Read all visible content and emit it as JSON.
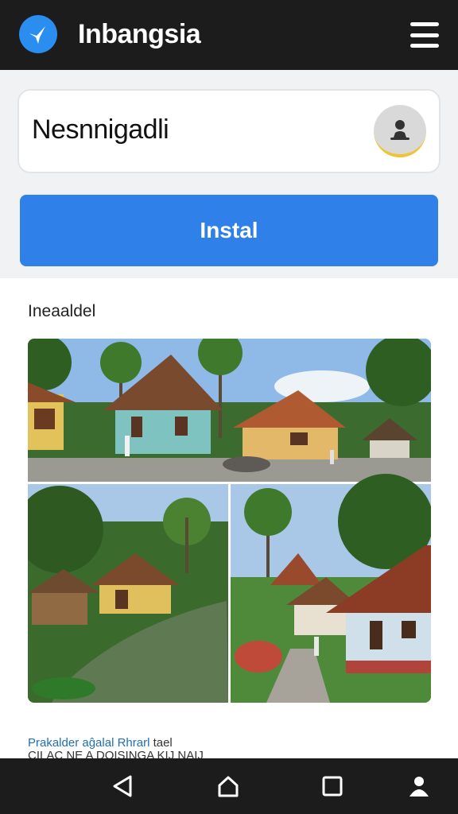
{
  "app": {
    "title": "Inbangsia",
    "logo_icon": "bird-icon",
    "menu_icon": "hamburger-menu-icon"
  },
  "search": {
    "value": "Nesnnigadli",
    "avatar_icon": "user-avatar-icon"
  },
  "install_button": {
    "label": "Instal"
  },
  "section": {
    "title": "Ineaaldel"
  },
  "gallery": {
    "description": "Collage of traditional village houses among palm trees, a pond and stone paths"
  },
  "caption": {
    "link_text": "Prakalder aĝalal Rhrarl",
    "rest_text": " tael",
    "subline": "CILAC NE A DOISINGA KIJ NAIJ"
  },
  "navbar": {
    "back_icon": "back-triangle-icon",
    "home_icon": "home-icon",
    "recents_icon": "recents-square-icon",
    "profile_icon": "person-icon"
  },
  "colors": {
    "topbar": "#1c1c1c",
    "accent": "#2f80e8",
    "logo": "#2a8df0",
    "panel": "#f1f2f4"
  }
}
